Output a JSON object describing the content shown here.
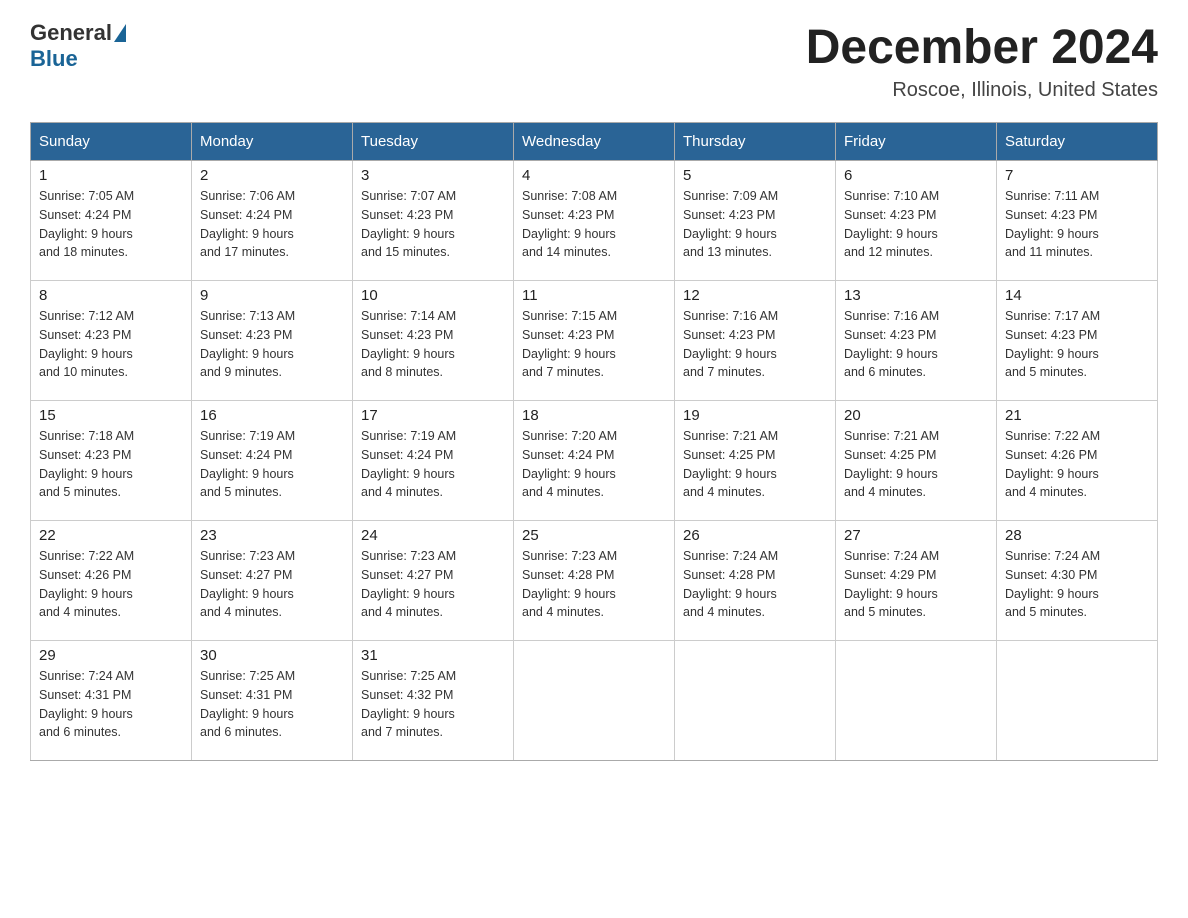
{
  "logo": {
    "general": "General",
    "blue": "Blue"
  },
  "title": "December 2024",
  "subtitle": "Roscoe, Illinois, United States",
  "days_of_week": [
    "Sunday",
    "Monday",
    "Tuesday",
    "Wednesday",
    "Thursday",
    "Friday",
    "Saturday"
  ],
  "weeks": [
    [
      {
        "num": "1",
        "sunrise": "7:05 AM",
        "sunset": "4:24 PM",
        "daylight": "9 hours and 18 minutes."
      },
      {
        "num": "2",
        "sunrise": "7:06 AM",
        "sunset": "4:24 PM",
        "daylight": "9 hours and 17 minutes."
      },
      {
        "num": "3",
        "sunrise": "7:07 AM",
        "sunset": "4:23 PM",
        "daylight": "9 hours and 15 minutes."
      },
      {
        "num": "4",
        "sunrise": "7:08 AM",
        "sunset": "4:23 PM",
        "daylight": "9 hours and 14 minutes."
      },
      {
        "num": "5",
        "sunrise": "7:09 AM",
        "sunset": "4:23 PM",
        "daylight": "9 hours and 13 minutes."
      },
      {
        "num": "6",
        "sunrise": "7:10 AM",
        "sunset": "4:23 PM",
        "daylight": "9 hours and 12 minutes."
      },
      {
        "num": "7",
        "sunrise": "7:11 AM",
        "sunset": "4:23 PM",
        "daylight": "9 hours and 11 minutes."
      }
    ],
    [
      {
        "num": "8",
        "sunrise": "7:12 AM",
        "sunset": "4:23 PM",
        "daylight": "9 hours and 10 minutes."
      },
      {
        "num": "9",
        "sunrise": "7:13 AM",
        "sunset": "4:23 PM",
        "daylight": "9 hours and 9 minutes."
      },
      {
        "num": "10",
        "sunrise": "7:14 AM",
        "sunset": "4:23 PM",
        "daylight": "9 hours and 8 minutes."
      },
      {
        "num": "11",
        "sunrise": "7:15 AM",
        "sunset": "4:23 PM",
        "daylight": "9 hours and 7 minutes."
      },
      {
        "num": "12",
        "sunrise": "7:16 AM",
        "sunset": "4:23 PM",
        "daylight": "9 hours and 7 minutes."
      },
      {
        "num": "13",
        "sunrise": "7:16 AM",
        "sunset": "4:23 PM",
        "daylight": "9 hours and 6 minutes."
      },
      {
        "num": "14",
        "sunrise": "7:17 AM",
        "sunset": "4:23 PM",
        "daylight": "9 hours and 5 minutes."
      }
    ],
    [
      {
        "num": "15",
        "sunrise": "7:18 AM",
        "sunset": "4:23 PM",
        "daylight": "9 hours and 5 minutes."
      },
      {
        "num": "16",
        "sunrise": "7:19 AM",
        "sunset": "4:24 PM",
        "daylight": "9 hours and 5 minutes."
      },
      {
        "num": "17",
        "sunrise": "7:19 AM",
        "sunset": "4:24 PM",
        "daylight": "9 hours and 4 minutes."
      },
      {
        "num": "18",
        "sunrise": "7:20 AM",
        "sunset": "4:24 PM",
        "daylight": "9 hours and 4 minutes."
      },
      {
        "num": "19",
        "sunrise": "7:21 AM",
        "sunset": "4:25 PM",
        "daylight": "9 hours and 4 minutes."
      },
      {
        "num": "20",
        "sunrise": "7:21 AM",
        "sunset": "4:25 PM",
        "daylight": "9 hours and 4 minutes."
      },
      {
        "num": "21",
        "sunrise": "7:22 AM",
        "sunset": "4:26 PM",
        "daylight": "9 hours and 4 minutes."
      }
    ],
    [
      {
        "num": "22",
        "sunrise": "7:22 AM",
        "sunset": "4:26 PM",
        "daylight": "9 hours and 4 minutes."
      },
      {
        "num": "23",
        "sunrise": "7:23 AM",
        "sunset": "4:27 PM",
        "daylight": "9 hours and 4 minutes."
      },
      {
        "num": "24",
        "sunrise": "7:23 AM",
        "sunset": "4:27 PM",
        "daylight": "9 hours and 4 minutes."
      },
      {
        "num": "25",
        "sunrise": "7:23 AM",
        "sunset": "4:28 PM",
        "daylight": "9 hours and 4 minutes."
      },
      {
        "num": "26",
        "sunrise": "7:24 AM",
        "sunset": "4:28 PM",
        "daylight": "9 hours and 4 minutes."
      },
      {
        "num": "27",
        "sunrise": "7:24 AM",
        "sunset": "4:29 PM",
        "daylight": "9 hours and 5 minutes."
      },
      {
        "num": "28",
        "sunrise": "7:24 AM",
        "sunset": "4:30 PM",
        "daylight": "9 hours and 5 minutes."
      }
    ],
    [
      {
        "num": "29",
        "sunrise": "7:24 AM",
        "sunset": "4:31 PM",
        "daylight": "9 hours and 6 minutes."
      },
      {
        "num": "30",
        "sunrise": "7:25 AM",
        "sunset": "4:31 PM",
        "daylight": "9 hours and 6 minutes."
      },
      {
        "num": "31",
        "sunrise": "7:25 AM",
        "sunset": "4:32 PM",
        "daylight": "9 hours and 7 minutes."
      },
      null,
      null,
      null,
      null
    ]
  ],
  "labels": {
    "sunrise": "Sunrise:",
    "sunset": "Sunset:",
    "daylight": "Daylight:"
  }
}
